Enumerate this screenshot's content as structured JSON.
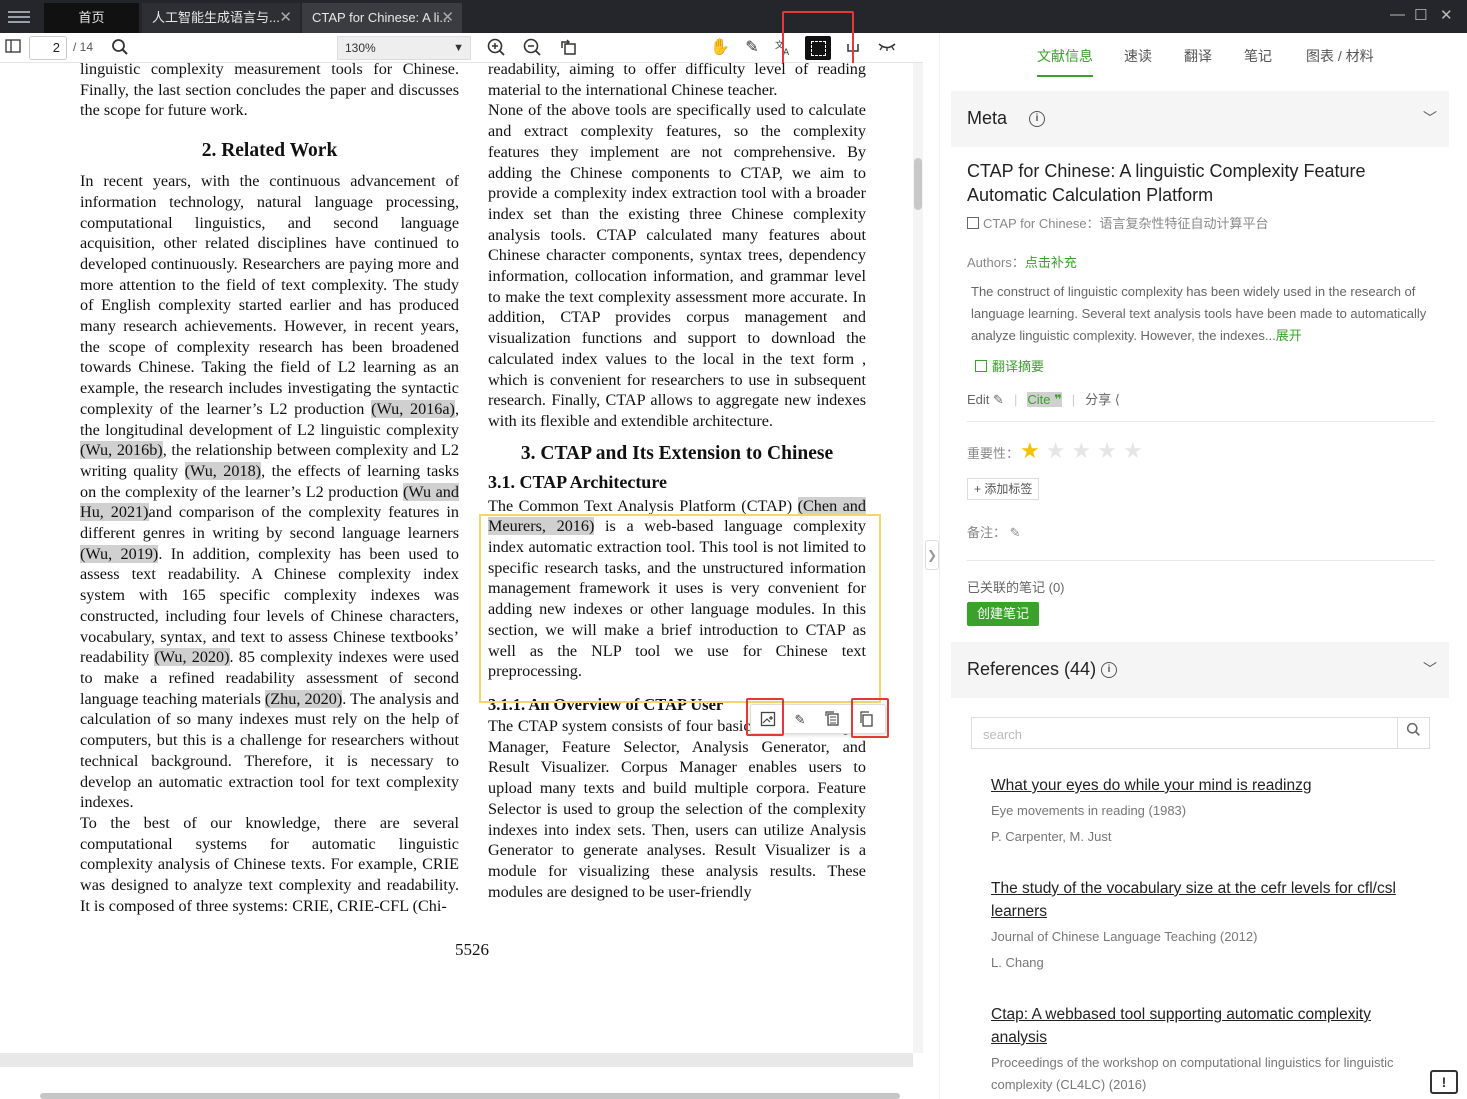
{
  "titlebar": {
    "tabs": [
      {
        "label": "首页"
      },
      {
        "label": "人工智能生成语言与..."
      },
      {
        "label": "CTAP for Chinese: A li..."
      }
    ],
    "close_glyph": "✕",
    "window_controls": [
      "—",
      "☐",
      "✕"
    ]
  },
  "toolbar": {
    "page_current": "2",
    "page_total": "/ 14",
    "zoom": "130%",
    "icons": [
      "sidebar-toggle-icon",
      "search-icon",
      "zoom-in-icon",
      "zoom-out-icon",
      "rotate-icon",
      "hand-icon",
      "pen-icon",
      "translate-icon",
      "crop-icon",
      "underline-icon",
      "eye-icon"
    ]
  },
  "document": {
    "left_col": {
      "intro_tail": "linguistic complexity measurement tools for Chinese. Finally, the last section concludes the paper and discusses the scope for future work.",
      "section2_title": "2.    Related Work",
      "p1a": "In recent years, with the continuous advancement of information technology, natural language processing, computational linguistics, and second language acquisition, other related disciplines have continued to developed continuously.  Researchers are paying more and more attention to the field of text complexity. The study of English complexity started earlier and has produced many research achievements. However, in recent years, the scope of complexity research has been broadened towards Chinese.  Taking the field of L2 learning as an example, the research includes investigating the syntactic complexity of the learner’s L2 production ",
      "cite1": "(Wu, 2016a)",
      "p1b": ", the longitudinal development of L2 linguistic complexity ",
      "cite2": "(Wu, 2016b)",
      "p1c": ", the relationship between complexity and L2 writing quality ",
      "cite3": "(Wu, 2018)",
      "p1d": ", the effects of learning tasks on the complexity of the learner’s L2 production ",
      "cite4": "(Wu and Hu, 2021)",
      "p1e": "and comparison of the complexity features in different genres in writing by second language learners ",
      "cite5": "(Wu, 2019)",
      "p1f": ". In addition, complexity has been used to assess text readability.  A Chinese complexity index system with 165 specific complexity indexes was constructed, including four levels of Chinese characters, vocabulary, syntax, and text to assess Chinese textbooks’ readability ",
      "cite6": "(Wu, 2020)",
      "p1g": ". 85 complexity indexes were used to make a refined readability assessment of second language teaching materials ",
      "cite7": "(Zhu, 2020)",
      "p1h": ". The analysis and calculation of so many indexes must rely on the help of computers, but this is a challenge for researchers without technical background.  Therefore, it is necessary to develop an automatic extraction tool for text complexity indexes.",
      "p2": "To the best of our knowledge, there are several computational systems for automatic linguistic complexity analysis of Chinese texts. For example, CRIE was designed to analyze text complexity and readability.  It is composed of three systems: CRIE, CRIE-CFL (Chi-"
    },
    "right_col": {
      "top_tail": "readability, aiming to offer difficulty level of reading material to the international Chinese teacher.",
      "p1": "None of the above tools are specifically used to calculate and extract complexity features, so the complexity features they implement are not comprehensive.  By adding the Chinese components to CTAP, we aim to provide a complexity index extraction tool with a broader index set than the existing three Chinese complexity analysis tools. CTAP calculated many features about Chinese character components, syntax trees, dependency information, collocation information, and grammar level to make the text complexity assessment more accurate.  In addition, CTAP provides corpus management and visualization functions and support to download the calculated index values to the local in the text form , which is convenient for researchers to use in subsequent research. Finally, CTAP allows to aggregate new indexes with its flexible and extendible architecture.",
      "section3_title": "3.    CTAP and Its Extension to Chinese",
      "sub31_title": "3.1.    CTAP Architecture",
      "p2a": "The Common Text Analysis Platform (CTAP) ",
      "cite_chen": "(Chen and Meurers, 2016)",
      "p2b": " is a web-based language complexity index automatic extraction tool. This tool is not limited to specific research tasks, and the unstructured information management framework it uses is very convenient for adding new indexes or other language modules. In this section, we will make a brief introduction to CTAP as well as the NLP tool we use for Chinese text preprocessing.",
      "sub311_title": "3.1.1.    An Overview of CTAP User",
      "p3": "The CTAP system consists of four basic modules: Corpus Manager, Feature Selector, Analysis Generator, and Result Visualizer.  Corpus Manager enables users to upload many texts and build multiple corpora. Feature Selector is used to group the selection of the complexity indexes into index sets.  Then, users can utilize Analysis Generator to generate analyses.  Result Visualizer is a module for visualizing these analysis results.  These modules are designed to be user-friendly"
    },
    "page_number": "5526",
    "float_tools": [
      "image-translate-icon",
      "pencil-icon",
      "copy-format-icon",
      "copy-icon"
    ]
  },
  "panel": {
    "tabs": [
      {
        "label": "文献信息",
        "active": true
      },
      {
        "label": "速读"
      },
      {
        "label": "翻译"
      },
      {
        "label": "笔记"
      },
      {
        "label": "图表 / 材料"
      }
    ],
    "meta": {
      "title": "Meta",
      "paper_title": "CTAP for Chinese: A linguistic Complexity Feature Automatic Calculation Platform",
      "translated_title": "CTAP for Chinese：语言复杂性特征自动计算平台",
      "authors_label": "Authors：",
      "authors_link": "点击补充",
      "abstract": "The construct of linguistic complexity has been widely used in the research of language learning. Several text analysis tools have been made to automatically analyze linguistic complexity. However, the indexes...",
      "expand": "展开",
      "translate_abstract": "翻译摘要",
      "edit": "Edit",
      "cite": "Cite",
      "share": "分享",
      "importance_label": "重要性：",
      "importance": 1,
      "importance_max": 5,
      "add_tag": "+ 添加标签",
      "note_label": "备注：",
      "linked_notes": "已关联的笔记 (0)",
      "create_note": "创建笔记"
    },
    "references": {
      "title": "References (44)",
      "search_placeholder": "search",
      "items": [
        {
          "title": "What your eyes do while your mind is readinzg",
          "venue": "Eye movements in reading (1983)",
          "authors": "P. Carpenter, M. Just"
        },
        {
          "title": "The study of the vocabulary size at the cefr levels for cfl/csl learners",
          "venue": "Journal of Chinese Language Teaching (2012)",
          "authors": "L. Chang"
        },
        {
          "title": "Ctap: A webbased tool supporting automatic complexity analysis",
          "venue": "Proceedings of the workshop on computational linguistics for linguistic complexity (CL4LC) (2016)",
          "authors": ""
        }
      ]
    },
    "feedback": "!"
  },
  "colors": {
    "accent": "#3aa12b",
    "titlebar": "#24262b",
    "highlight_border": "#f5d66b",
    "callout_red": "#e53935",
    "star": "#f6c200"
  }
}
